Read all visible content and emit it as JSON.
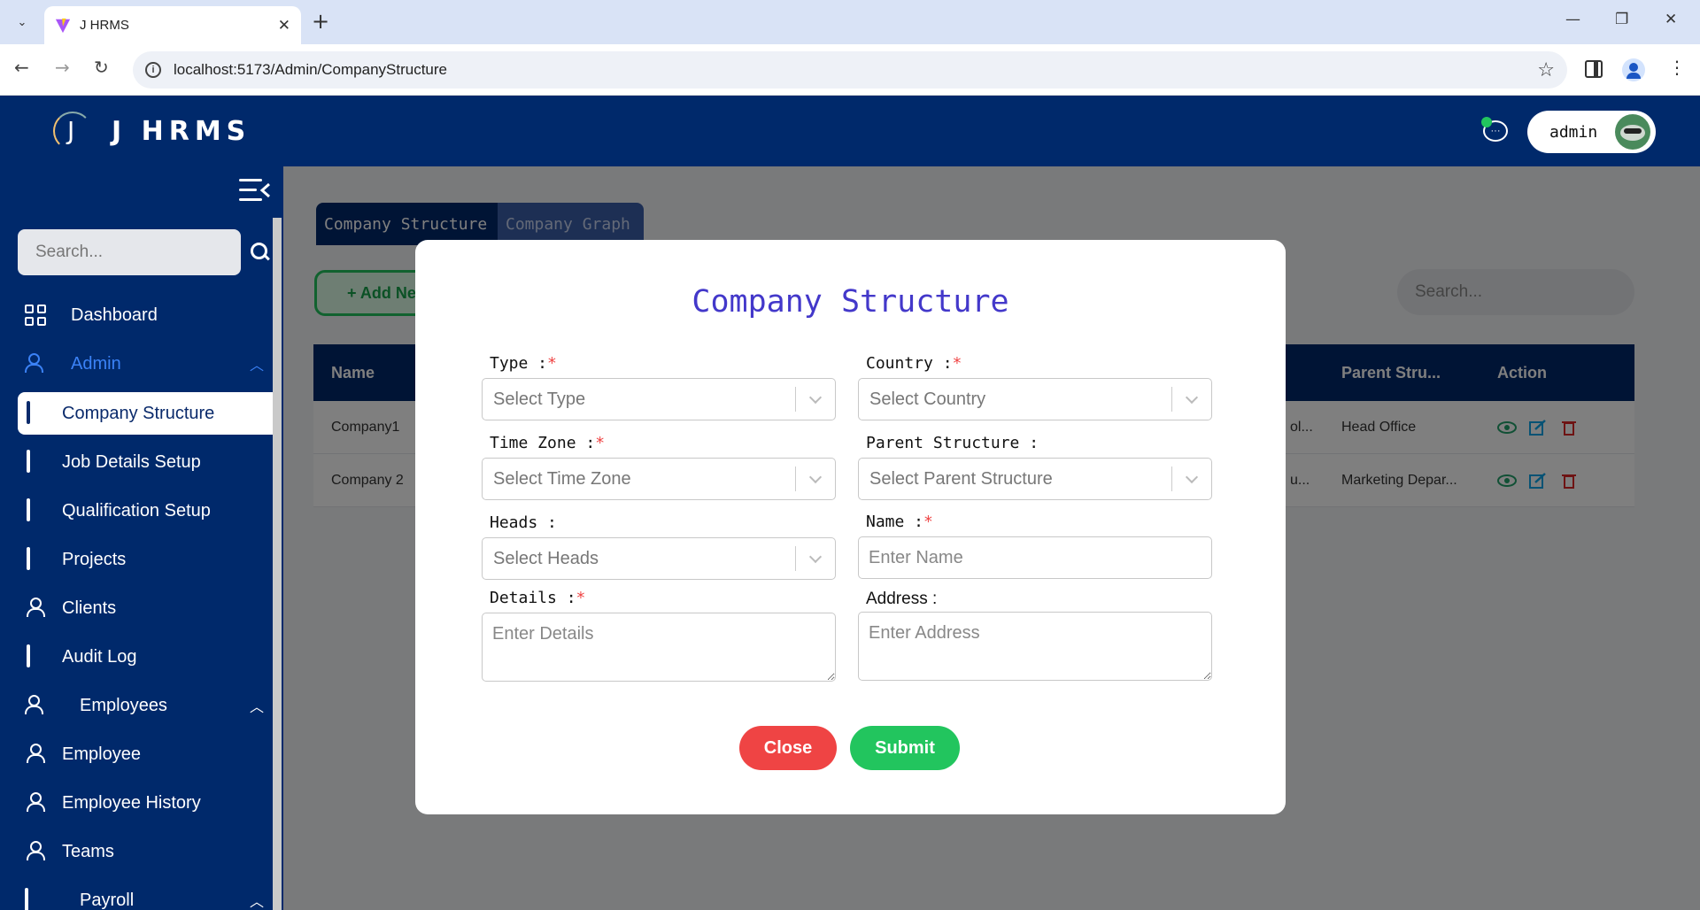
{
  "browser": {
    "tab_title": "J HRMS",
    "url": "localhost:5173/Admin/CompanyStructure"
  },
  "header": {
    "logo_text": "J HRMS",
    "username": "admin"
  },
  "sidebar": {
    "search_placeholder": "Search...",
    "items": [
      {
        "label": "Dashboard",
        "icon": "dashboard-icon"
      },
      {
        "label": "Admin",
        "icon": "admin-icon",
        "expanded": true
      },
      {
        "label": "Company Structure",
        "icon": "company-structure-icon",
        "active": true
      },
      {
        "label": "Job Details Setup",
        "icon": "job-details-icon"
      },
      {
        "label": "Qualification Setup",
        "icon": "qualification-icon"
      },
      {
        "label": "Projects",
        "icon": "projects-icon"
      },
      {
        "label": "Clients",
        "icon": "clients-icon"
      },
      {
        "label": "Audit Log",
        "icon": "audit-log-icon"
      },
      {
        "label": "Employees",
        "icon": "employees-icon",
        "expanded": true
      },
      {
        "label": "Employee",
        "icon": "employee-icon"
      },
      {
        "label": "Employee History",
        "icon": "employee-history-icon"
      },
      {
        "label": "Teams",
        "icon": "teams-icon"
      },
      {
        "label": "Payroll",
        "icon": "payroll-icon",
        "expanded": true
      }
    ]
  },
  "main": {
    "tabs": [
      "Company Structure",
      "Company Graph"
    ],
    "add_new_label": "+ Add Ne",
    "search_placeholder": "Search...",
    "table": {
      "headers": {
        "name": "Name",
        "parent": "Parent Stru...",
        "action": "Action"
      },
      "rows": [
        {
          "name": "Company1",
          "partial": "ol...",
          "parent": "Head Office"
        },
        {
          "name": "Company 2",
          "partial": "u...",
          "parent": "Marketing Depar..."
        }
      ]
    }
  },
  "modal": {
    "title": "Company Structure",
    "type_label": "Type :",
    "type_placeholder": "Select Type",
    "country_label": "Country :",
    "country_placeholder": "Select Country",
    "timezone_label": "Time Zone :",
    "timezone_placeholder": "Select Time Zone",
    "parent_label": "Parent Structure :",
    "parent_placeholder": "Select Parent Structure",
    "heads_label": "Heads :",
    "heads_placeholder": "Select Heads",
    "name_label": "Name :",
    "name_placeholder": "Enter Name",
    "details_label": "Details :",
    "details_placeholder": "Enter Details",
    "address_label": "Address :",
    "address_placeholder": "Enter Address",
    "required_marker": "*",
    "close_label": "Close",
    "submit_label": "Submit"
  },
  "colors": {
    "navy": "#00296b",
    "accent_blue": "#3b82f6",
    "title_purple": "#4338ca",
    "required_red": "#ef4444",
    "close_red": "#ef4444",
    "submit_green": "#22c55e"
  }
}
